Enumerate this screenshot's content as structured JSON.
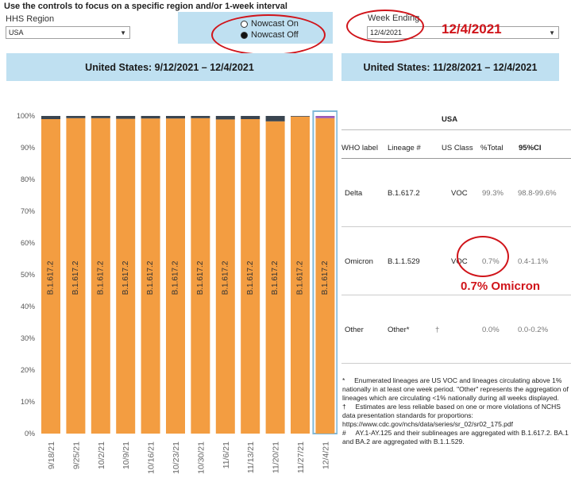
{
  "instructions": "Use the controls to focus on a specific region and/or 1-week interval",
  "controls": {
    "region_label": "HHS Region",
    "region_value": "USA",
    "nowcast_on": "Nowcast On",
    "nowcast_off": "Nowcast Off",
    "nowcast_selected": "off",
    "week_label": "Week Ending",
    "week_value": "12/4/2021",
    "week_annotation": "12/4/2021"
  },
  "left_panel": {
    "title": "United States: 9/12/2021 – 12/4/2021"
  },
  "right_panel": {
    "title": "United States: 11/28/2021 – 12/4/2021",
    "table_region": "USA",
    "columns": [
      "WHO label",
      "Lineage #",
      "US Class",
      "%Total",
      "95%CI"
    ],
    "rows": [
      {
        "who": "Delta",
        "lineage": "B.1.617.2",
        "flag": "",
        "us_class": "VOC",
        "pct": "99.3%",
        "ci": "98.8-99.6%"
      },
      {
        "who": "Omicron",
        "lineage": "B.1.1.529",
        "flag": "",
        "us_class": "VOC",
        "pct": "0.7%",
        "ci": "0.4-1.1%"
      },
      {
        "who": "Other",
        "lineage": "Other*",
        "flag": "†",
        "us_class": "",
        "pct": "0.0%",
        "ci": "0.0-0.2%"
      }
    ],
    "omicron_annotation": "0.7% Omicron",
    "footnotes": [
      "*     Enumerated lineages are US VOC and lineages circulating above 1% nationally in at least one week period. \"Other\" represents the aggregation of lineages which are circulating <1% nationally during all weeks displayed.",
      "†     Estimates are less reliable based on one or more violations of NCHS data presentation standards for proportions: https://www.cdc.gov/nchs/data/series/sr_02/sr02_175.pdf",
      "#     AY.1-AY.125 and their sublineages are aggregated with B.1.617.2. BA.1 and BA.2 are aggregated with B.1.1.529."
    ]
  },
  "colors": {
    "delta": "#f39d41",
    "other": "#3a4550",
    "omicron": "#9b59b6",
    "header_bg": "#bfe0f1",
    "annotation": "#d0141a"
  },
  "chart_data": {
    "type": "bar",
    "stacked": true,
    "categories": [
      "9/18/21",
      "9/25/21",
      "10/2/21",
      "10/9/21",
      "10/16/21",
      "10/23/21",
      "10/30/21",
      "11/6/21",
      "11/13/21",
      "11/20/21",
      "11/27/21",
      "12/4/21"
    ],
    "series": [
      {
        "name": "B.1.617.2",
        "values": [
          99.0,
          99.3,
          99.3,
          99.1,
          99.2,
          99.2,
          99.3,
          98.9,
          99.0,
          98.3,
          99.8,
          99.3
        ]
      },
      {
        "name": "Other",
        "values": [
          1.0,
          0.7,
          0.7,
          0.9,
          0.8,
          0.8,
          0.7,
          1.1,
          1.0,
          1.7,
          0.2,
          0.0
        ]
      },
      {
        "name": "B.1.1.529",
        "values": [
          0,
          0,
          0,
          0,
          0,
          0,
          0,
          0,
          0,
          0,
          0,
          0.7
        ]
      }
    ],
    "bar_labels": [
      "B.1.617.2",
      "B.1.617.2",
      "B.1.617.2",
      "B.1.617.2",
      "B.1.617.2",
      "B.1.617.2",
      "B.1.617.2",
      "B.1.617.2",
      "B.1.617.2",
      "B.1.617.2",
      "B.1.617.2",
      "B.1.617.2"
    ],
    "yticks": [
      "0%",
      "10%",
      "20%",
      "30%",
      "40%",
      "50%",
      "60%",
      "70%",
      "80%",
      "90%",
      "100%"
    ],
    "ylim": [
      0,
      100
    ],
    "highlighted_category": "12/4/21"
  }
}
